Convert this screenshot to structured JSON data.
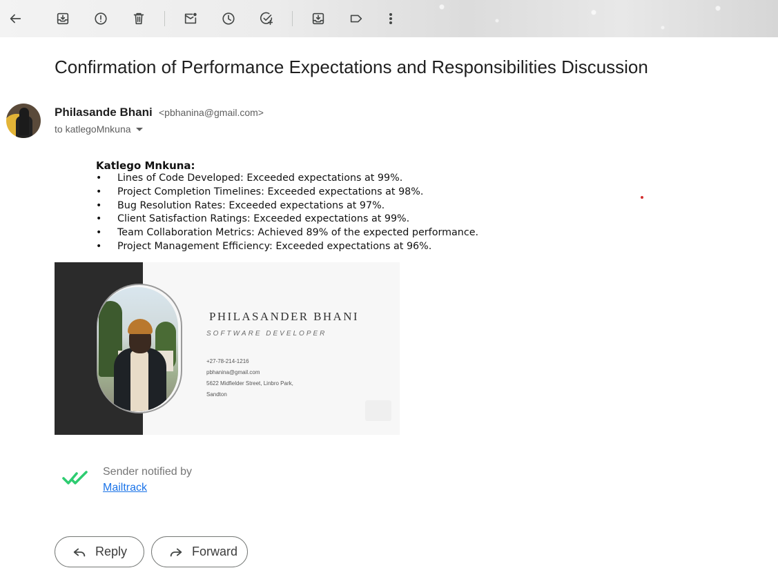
{
  "toolbar": {
    "icons": [
      "back-arrow-icon",
      "archive-icon",
      "report-spam-icon",
      "delete-icon",
      "mark-unread-icon",
      "snooze-icon",
      "add-to-tasks-icon",
      "move-to-icon",
      "label-icon",
      "more-options-icon"
    ]
  },
  "email": {
    "subject": "Confirmation of Performance Expectations and Responsibilities Discussion",
    "sender_name": "Philasande Bhani",
    "sender_email": "<pbhanina@gmail.com>",
    "to_line": "to katlegoMnkuna"
  },
  "body": {
    "recipient_heading": "Katlego Mnkuna:",
    "metrics": [
      "Lines of Code Developed: Exceeded expectations at 99%.",
      "Project Completion Timelines: Exceeded expectations at 98%.",
      "Bug Resolution Rates: Exceeded expectations at 97%.",
      "Client Satisfaction Ratings: Exceeded expectations at 99%.",
      "Team Collaboration Metrics: Achieved 89% of the expected performance.",
      "Project Management Efficiency: Exceeded expectations at 96%."
    ]
  },
  "business_card": {
    "name": "PHILASANDER BHANI",
    "role": "SOFTWARE DEVELOPER",
    "phone": "+27-78-214-1216",
    "email": "pbhanina@gmail.com",
    "address_line1": "5622 Midfielder Street, Linbro Park,",
    "address_line2": "Sandton",
    "colors": {
      "panel_dark": "#2b2b2b",
      "background": "#f7f7f7"
    }
  },
  "mailtrack": {
    "text": "Sender notified by",
    "link_text": "Mailtrack",
    "check_color": "#2ecc71"
  },
  "actions": {
    "reply_label": "Reply",
    "forward_label": "Forward"
  }
}
